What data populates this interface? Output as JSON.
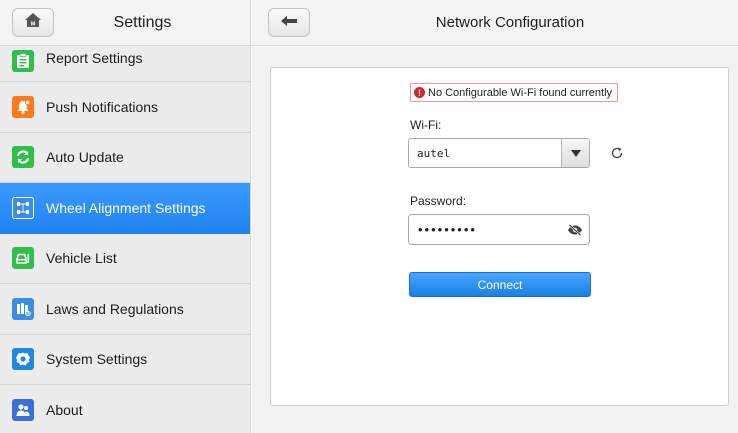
{
  "sidebar": {
    "title": "Settings",
    "items": [
      {
        "label": "Report Settings",
        "icon": "report-icon",
        "color": "#2fbf4a"
      },
      {
        "label": "Push Notifications",
        "icon": "bell-icon",
        "color": "#ff7a1a"
      },
      {
        "label": "Auto Update",
        "icon": "update-icon",
        "color": "#2fbf4a"
      },
      {
        "label": "Wheel Alignment Settings",
        "icon": "wheel-alignment-icon",
        "color": "#3a8ee6",
        "active": true
      },
      {
        "label": "Vehicle List",
        "icon": "vehicle-icon",
        "color": "#2fbf4a"
      },
      {
        "label": "Laws and Regulations",
        "icon": "laws-icon",
        "color": "#3a8ee6"
      },
      {
        "label": "System Settings",
        "icon": "gear-icon",
        "color": "#1e88e5"
      },
      {
        "label": "About",
        "icon": "about-icon",
        "color": "#3a6fd6"
      }
    ]
  },
  "main": {
    "title": "Network Configuration",
    "warning": "No Configurable Wi-Fi found currently",
    "wifi_label": "Wi-Fi:",
    "wifi_value": "autel",
    "password_label": "Password:",
    "password_mask": "•••••••••",
    "connect_label": "Connect"
  },
  "colors": {
    "accent": "#1f82ee",
    "warning_border": "#ef9a9a",
    "warning_icon": "#d7262b"
  }
}
